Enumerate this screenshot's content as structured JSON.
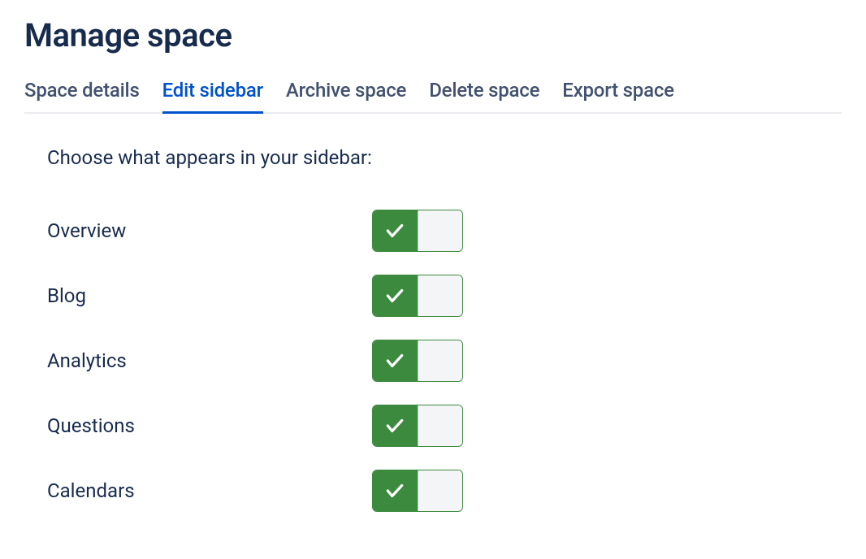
{
  "header": {
    "title": "Manage space"
  },
  "tabs": [
    {
      "id": "space-details",
      "label": "Space details",
      "active": false
    },
    {
      "id": "edit-sidebar",
      "label": "Edit sidebar",
      "active": true
    },
    {
      "id": "archive-space",
      "label": "Archive space",
      "active": false
    },
    {
      "id": "delete-space",
      "label": "Delete space",
      "active": false
    },
    {
      "id": "export-space",
      "label": "Export space",
      "active": false
    }
  ],
  "content": {
    "instruction": "Choose what appears in your sidebar:",
    "options": [
      {
        "id": "overview",
        "label": "Overview",
        "enabled": true
      },
      {
        "id": "blog",
        "label": "Blog",
        "enabled": true
      },
      {
        "id": "analytics",
        "label": "Analytics",
        "enabled": true
      },
      {
        "id": "questions",
        "label": "Questions",
        "enabled": true
      },
      {
        "id": "calendars",
        "label": "Calendars",
        "enabled": true
      }
    ]
  }
}
